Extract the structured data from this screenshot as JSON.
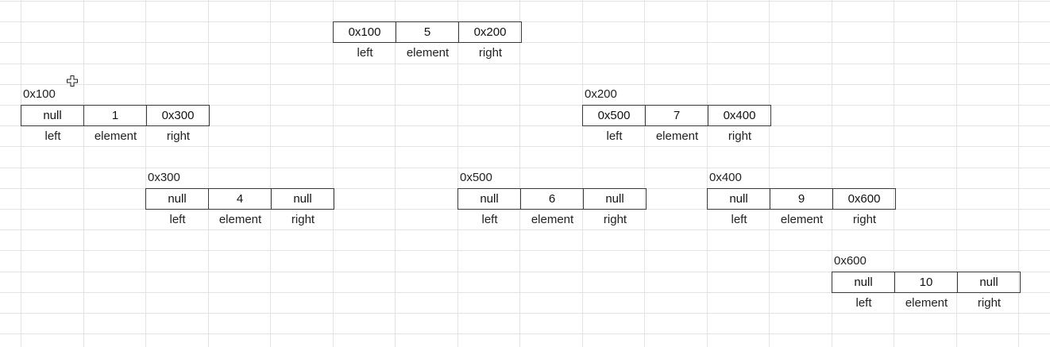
{
  "field_labels": {
    "left": "left",
    "element": "element",
    "right": "right"
  },
  "nodes": [
    {
      "id": "root",
      "address": "",
      "left": "0x100",
      "element": "5",
      "right": "0x200"
    },
    {
      "id": "n0x100",
      "address": "0x100",
      "left": "null",
      "element": "1",
      "right": "0x300"
    },
    {
      "id": "n0x200",
      "address": "0x200",
      "left": "0x500",
      "element": "7",
      "right": "0x400"
    },
    {
      "id": "n0x300",
      "address": "0x300",
      "left": "null",
      "element": "4",
      "right": "null"
    },
    {
      "id": "n0x500",
      "address": "0x500",
      "left": "null",
      "element": "6",
      "right": "null"
    },
    {
      "id": "n0x400",
      "address": "0x400",
      "left": "null",
      "element": "9",
      "right": "0x600"
    },
    {
      "id": "n0x600",
      "address": "0x600",
      "left": "null",
      "element": "10",
      "right": "null"
    }
  ]
}
